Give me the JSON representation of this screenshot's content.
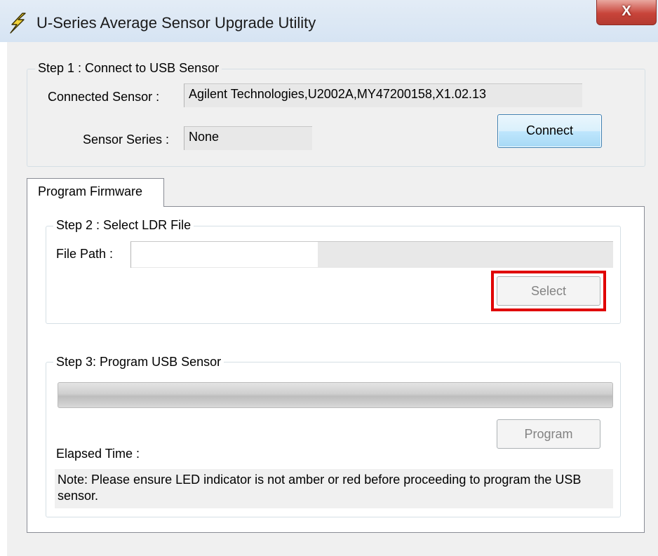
{
  "window": {
    "title": "U-Series Average Sensor Upgrade Utility",
    "close_label": "X"
  },
  "step1": {
    "legend": "Step 1 : Connect to USB Sensor",
    "connected_sensor_label": "Connected Sensor :",
    "connected_sensor_value": "Agilent Technologies,U2002A,MY47200158,X1.02.13",
    "sensor_series_label": "Sensor Series :",
    "sensor_series_value": "None",
    "connect_button": "Connect"
  },
  "tabs": [
    {
      "label": "Program Firmware",
      "selected": true
    }
  ],
  "step2": {
    "legend": "Step 2 : Select LDR File",
    "file_path_label": "File Path :",
    "file_path_value": "",
    "select_button": "Select"
  },
  "step3": {
    "legend": "Step 3: Program USB Sensor",
    "progress_fraction": 0,
    "program_button": "Program",
    "elapsed_time_label": "Elapsed Time :",
    "note": "Note: Please ensure LED indicator is not amber or red before proceeding to program the USB sensor."
  },
  "colors": {
    "highlight": "#e00000",
    "connect_border": "#3c7fb1"
  },
  "icons": {
    "app": "lightning-bolt-icon",
    "close": "close-icon"
  }
}
